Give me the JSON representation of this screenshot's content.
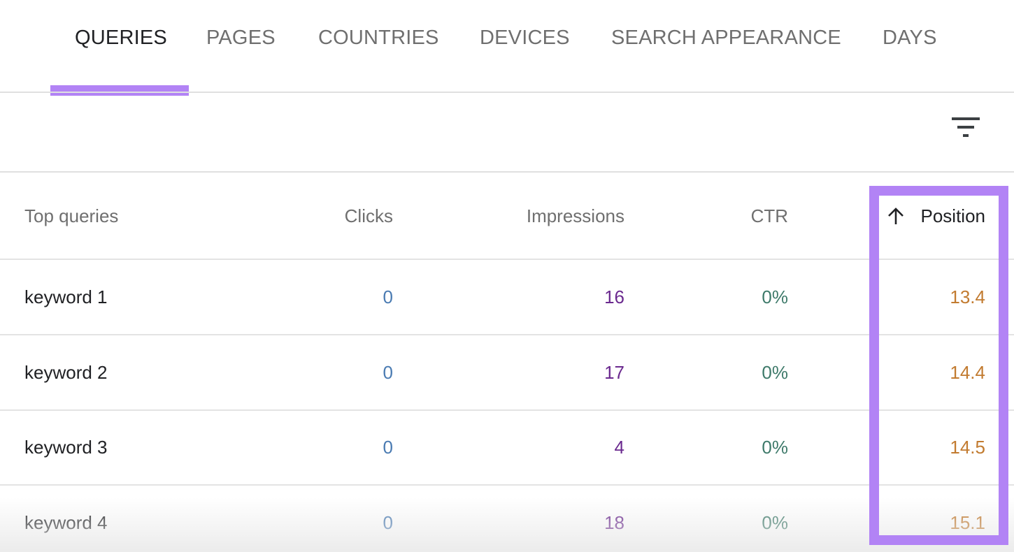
{
  "tabs": [
    {
      "label": "QUERIES",
      "active": true
    },
    {
      "label": "PAGES",
      "active": false
    },
    {
      "label": "COUNTRIES",
      "active": false
    },
    {
      "label": "DEVICES",
      "active": false
    },
    {
      "label": "SEARCH APPEARANCE",
      "active": false
    },
    {
      "label": "DAYS",
      "active": false
    }
  ],
  "toolbar": {
    "filter_icon": "filter-list-icon"
  },
  "table": {
    "headers": {
      "query": "Top queries",
      "clicks": "Clicks",
      "impressions": "Impressions",
      "ctr": "CTR",
      "position": "Position"
    },
    "sort": {
      "column": "position",
      "direction": "ascending",
      "icon": "arrow-up-icon"
    },
    "rows": [
      {
        "query": "keyword 1",
        "clicks": "0",
        "impressions": "16",
        "ctr": "0%",
        "position": "13.4"
      },
      {
        "query": "keyword 2",
        "clicks": "0",
        "impressions": "17",
        "ctr": "0%",
        "position": "14.4"
      },
      {
        "query": "keyword 3",
        "clicks": "0",
        "impressions": "4",
        "ctr": "0%",
        "position": "14.5"
      },
      {
        "query": "keyword 4",
        "clicks": "0",
        "impressions": "18",
        "ctr": "0%",
        "position": "15.1"
      }
    ]
  },
  "colors": {
    "accent": "#b283f5",
    "clicks": "#4a7bb2",
    "impressions": "#6b2a8f",
    "ctr": "#3e7a6a",
    "position": "#c27b30"
  }
}
